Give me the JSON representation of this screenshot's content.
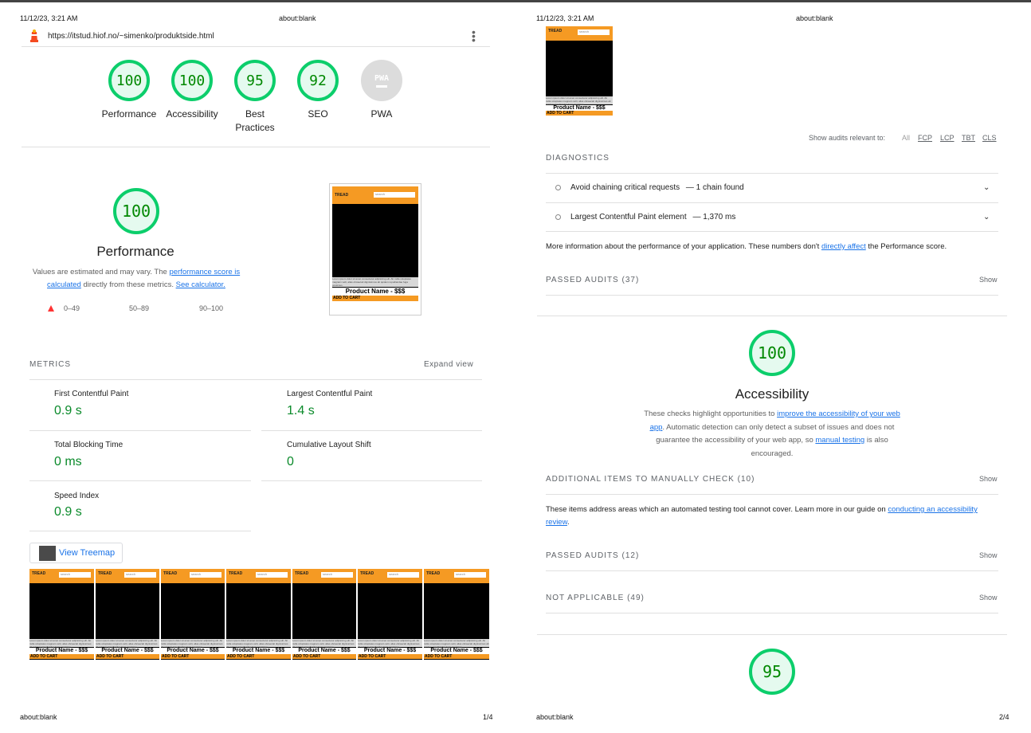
{
  "page1": {
    "datetime": "11/12/23, 3:21 AM",
    "header_title": "about:blank",
    "url": "https://itstud.hiof.no/~simenko/produktside.html",
    "gauges": [
      {
        "score": "100",
        "label": "Performance"
      },
      {
        "score": "100",
        "label": "Accessibility"
      },
      {
        "score": "95",
        "label": "Best Practices"
      },
      {
        "score": "92",
        "label": "SEO"
      },
      {
        "score": "PWA",
        "label": "PWA"
      }
    ],
    "perf": {
      "score": "100",
      "title": "Performance",
      "desc_1": "Values are estimated and may vary. The",
      "link_1": "performance score is calculated",
      "desc_2": "directly from these metrics.",
      "link_2": "See calculator.",
      "legend": [
        "0–49",
        "50–89",
        "90–100"
      ]
    },
    "metrics_heading": "METRICS",
    "expand_view": "Expand view",
    "metrics": [
      {
        "title": "First Contentful Paint",
        "value": "0.9 s"
      },
      {
        "title": "Largest Contentful Paint",
        "value": "1.4 s"
      },
      {
        "title": "Total Blocking Time",
        "value": "0 ms"
      },
      {
        "title": "Cumulative Layout Shift",
        "value": "0"
      },
      {
        "title": "Speed Index",
        "value": "0.9 s"
      }
    ],
    "treemap_button": "View Treemap",
    "footer_left": "about:blank",
    "footer_right": "1/4"
  },
  "phone": {
    "search": "search",
    "logo": "TREAD",
    "lorem": "Lorem ipsum dolor sit amet consectetur adipisicing elit. Ab nulla voluptates magnam velit, alias obcaecati dignissimos ab quidem repudiandae fuga possimus.",
    "product": "Product Name - $$$",
    "cart": "ADD TO CART"
  },
  "page2": {
    "datetime": "11/12/23, 3:21 AM",
    "header_title": "about:blank",
    "show_audits_label": "Show audits relevant to:",
    "filters": [
      "All",
      "FCP",
      "LCP",
      "TBT",
      "CLS"
    ],
    "diagnostics_heading": "DIAGNOSTICS",
    "diagnostics": [
      {
        "title": "Avoid chaining critical requests",
        "detail": "— 1 chain found"
      },
      {
        "title": "Largest Contentful Paint element",
        "detail": "— 1,370 ms"
      }
    ],
    "more_info_1": "More information about the performance of your application. These numbers don't",
    "more_info_link": "directly affect",
    "more_info_2": "the Performance score.",
    "passed_audits_1": "PASSED AUDITS",
    "passed_audits_1_count": "(37)",
    "show": "Show",
    "acc": {
      "score": "100",
      "title": "Accessibility",
      "desc_1": "These checks highlight opportunities to",
      "link_1": "improve the accessibility of your web app",
      "desc_2": ". Automatic detection can only detect a subset of issues and does not guarantee the accessibility of your web app, so",
      "link_2": "manual testing",
      "desc_3": "is also encouraged."
    },
    "manual_heading": "ADDITIONAL ITEMS TO MANUALLY CHECK",
    "manual_count": "(10)",
    "manual_text": "These items address areas which an automated testing tool cannot cover. Learn more in our guide on",
    "manual_link": "conducting an accessibility review",
    "passed_audits_2": "PASSED AUDITS",
    "passed_audits_2_count": "(12)",
    "not_applicable": "NOT APPLICABLE",
    "not_applicable_count": "(49)",
    "bp_score": "95",
    "footer_left": "about:blank",
    "footer_right": "2/4"
  }
}
